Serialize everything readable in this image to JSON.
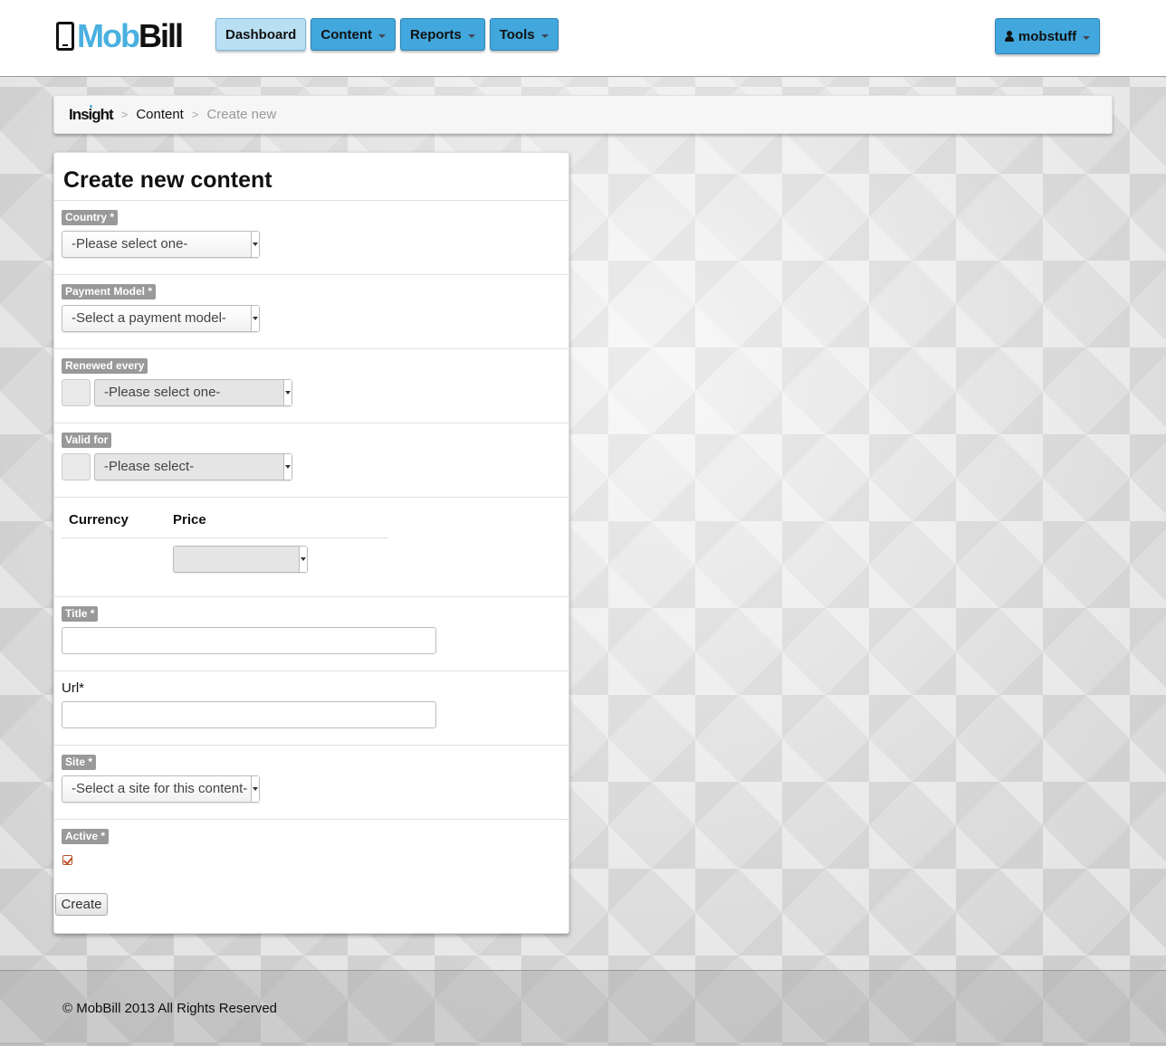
{
  "header": {
    "logo_mob": "Mob",
    "logo_bill": "Bill",
    "nav": [
      {
        "label": "Dashboard",
        "dropdown": false,
        "active": true
      },
      {
        "label": "Content",
        "dropdown": true
      },
      {
        "label": "Reports",
        "dropdown": true
      },
      {
        "label": "Tools",
        "dropdown": true
      }
    ],
    "user": "mobstuff"
  },
  "breadcrumb": {
    "root": "Insight",
    "sep": ">",
    "items": [
      "Content",
      "Create new"
    ]
  },
  "form": {
    "title": "Create new content",
    "country": {
      "label": "Country *",
      "value": "-Please select one-"
    },
    "payment_model": {
      "label": "Payment Model *",
      "value": "-Select a payment model-"
    },
    "renewed_every": {
      "label": "Renewed every",
      "value": "-Please select one-"
    },
    "valid_for": {
      "label": "Valid for",
      "value": "-Please select-"
    },
    "price_table": {
      "col_currency": "Currency",
      "col_price": "Price",
      "price_value": ""
    },
    "title_field": {
      "label": "Title *",
      "value": ""
    },
    "url_field": {
      "label": "Url*",
      "value": ""
    },
    "site": {
      "label": "Site *",
      "value": "-Select a site for this content-"
    },
    "active": {
      "label": "Active *",
      "checked": true
    },
    "submit_label": "Create"
  },
  "footer": {
    "text": "© MobBill 2013 All Rights Reserved"
  },
  "colors": {
    "accent": "#41a7dc",
    "logo_blue": "#4ab0e0",
    "tag_gray": "#999999",
    "checkbox": "#c0532a"
  }
}
